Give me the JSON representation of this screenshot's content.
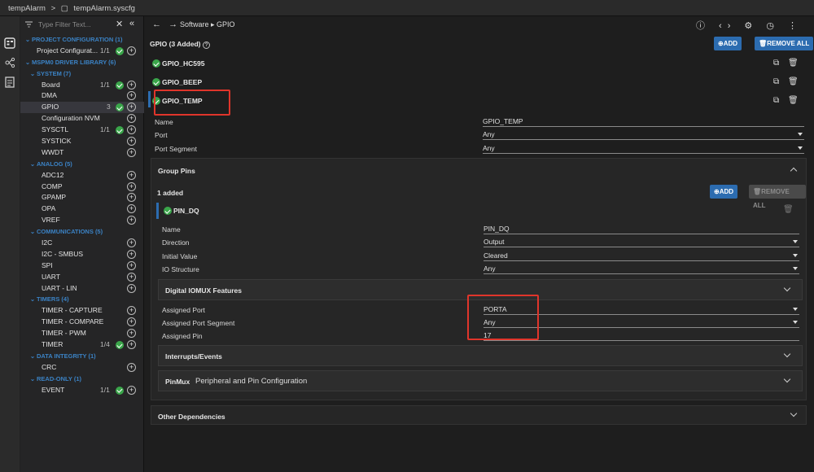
{
  "tabbar": {
    "file1": "tempAlarm",
    "sep": ">",
    "file2": "tempAlarm.syscfg"
  },
  "sidebar": {
    "filter_placeholder": "Type Filter Text...",
    "close": "✕",
    "collapse": "«",
    "tree": [
      {
        "kind": "cat",
        "label": "PROJECT CONFIGURATION (1)"
      },
      {
        "kind": "item",
        "label": "Project Configurat...",
        "count": "1/1",
        "ok": true,
        "plus": true,
        "indent": 1
      },
      {
        "kind": "cat",
        "label": "MSPM0 DRIVER LIBRARY (6)"
      },
      {
        "kind": "cat2",
        "label": "SYSTEM (7)"
      },
      {
        "kind": "item",
        "label": "Board",
        "count": "1/1",
        "ok": true,
        "plus": true
      },
      {
        "kind": "item",
        "label": "DMA",
        "count": "",
        "ok": false,
        "plus": true
      },
      {
        "kind": "item",
        "label": "GPIO",
        "count": "3",
        "ok": true,
        "plus": true,
        "selected": true
      },
      {
        "kind": "item",
        "label": "Configuration NVM",
        "count": "",
        "ok": false,
        "plus": true
      },
      {
        "kind": "item",
        "label": "SYSCTL",
        "count": "1/1",
        "ok": true,
        "plus": true
      },
      {
        "kind": "item",
        "label": "SYSTICK",
        "count": "",
        "ok": false,
        "plus": true
      },
      {
        "kind": "item",
        "label": "WWDT",
        "count": "",
        "ok": false,
        "plus": true
      },
      {
        "kind": "cat2",
        "label": "ANALOG (5)"
      },
      {
        "kind": "item",
        "label": "ADC12",
        "count": "",
        "ok": false,
        "plus": true
      },
      {
        "kind": "item",
        "label": "COMP",
        "count": "",
        "ok": false,
        "plus": true
      },
      {
        "kind": "item",
        "label": "GPAMP",
        "count": "",
        "ok": false,
        "plus": true
      },
      {
        "kind": "item",
        "label": "OPA",
        "count": "",
        "ok": false,
        "plus": true
      },
      {
        "kind": "item",
        "label": "VREF",
        "count": "",
        "ok": false,
        "plus": true
      },
      {
        "kind": "cat2",
        "label": "COMMUNICATIONS (5)"
      },
      {
        "kind": "item",
        "label": "I2C",
        "count": "",
        "ok": false,
        "plus": true
      },
      {
        "kind": "item",
        "label": "I2C - SMBUS",
        "count": "",
        "ok": false,
        "plus": true
      },
      {
        "kind": "item",
        "label": "SPI",
        "count": "",
        "ok": false,
        "plus": true
      },
      {
        "kind": "item",
        "label": "UART",
        "count": "",
        "ok": false,
        "plus": true
      },
      {
        "kind": "item",
        "label": "UART - LIN",
        "count": "",
        "ok": false,
        "plus": true
      },
      {
        "kind": "cat2",
        "label": "TIMERS (4)"
      },
      {
        "kind": "item",
        "label": "TIMER - CAPTURE",
        "count": "",
        "ok": false,
        "plus": true
      },
      {
        "kind": "item",
        "label": "TIMER - COMPARE",
        "count": "",
        "ok": false,
        "plus": true
      },
      {
        "kind": "item",
        "label": "TIMER - PWM",
        "count": "",
        "ok": false,
        "plus": true
      },
      {
        "kind": "item",
        "label": "TIMER",
        "count": "1/4",
        "ok": true,
        "plus": true
      },
      {
        "kind": "cat2",
        "label": "DATA INTEGRITY (1)"
      },
      {
        "kind": "item",
        "label": "CRC",
        "count": "",
        "ok": false,
        "plus": true
      },
      {
        "kind": "cat2",
        "label": "READ-ONLY (1)"
      },
      {
        "kind": "item",
        "label": "EVENT",
        "count": "1/1",
        "ok": true,
        "plus": true
      }
    ]
  },
  "main": {
    "nav_back": "←",
    "nav_fwd": "→",
    "path": "Software ▸ GPIO",
    "top_icons": "ⓘ ‹› ⚙ ◷ ⋮",
    "title": "GPIO (3 Added)",
    "help": "?",
    "add_label": "ADD",
    "remove_all_label": "REMOVE ALL",
    "instances": [
      "GPIO_HC595",
      "GPIO_BEEP",
      "GPIO_TEMP"
    ],
    "fields": {
      "name_label": "Name",
      "name_value": "GPIO_TEMP",
      "port_label": "Port",
      "port_value": "Any",
      "seg_label": "Port Segment",
      "seg_value": "Any"
    },
    "group_pins": {
      "title": "Group Pins",
      "added": "1 added",
      "add_label": "ADD",
      "remove_all_label": "REMOVE ALL",
      "pin": "PIN_DQ",
      "name_label": "Name",
      "name_value": "PIN_DQ",
      "dir_label": "Direction",
      "dir_value": "Output",
      "init_label": "Initial Value",
      "init_value": "Cleared",
      "io_label": "IO Structure",
      "io_value": "Any",
      "iomux_title": "Digital IOMUX Features",
      "aport_label": "Assigned Port",
      "aport_value": "PORTA",
      "aseg_label": "Assigned Port Segment",
      "aseg_value": "Any",
      "apin_label": "Assigned Pin",
      "apin_value": "17",
      "irq_title": "Interrupts/Events",
      "pinmux_title": "PinMux",
      "pinmux_sub": "Peripheral and Pin Configuration"
    },
    "other_title": "Other Dependencies"
  },
  "colors": {
    "accent": "#2c6cb0",
    "ok": "#3aa64a",
    "highlight": "#e0352b",
    "category": "#3b82c4"
  }
}
